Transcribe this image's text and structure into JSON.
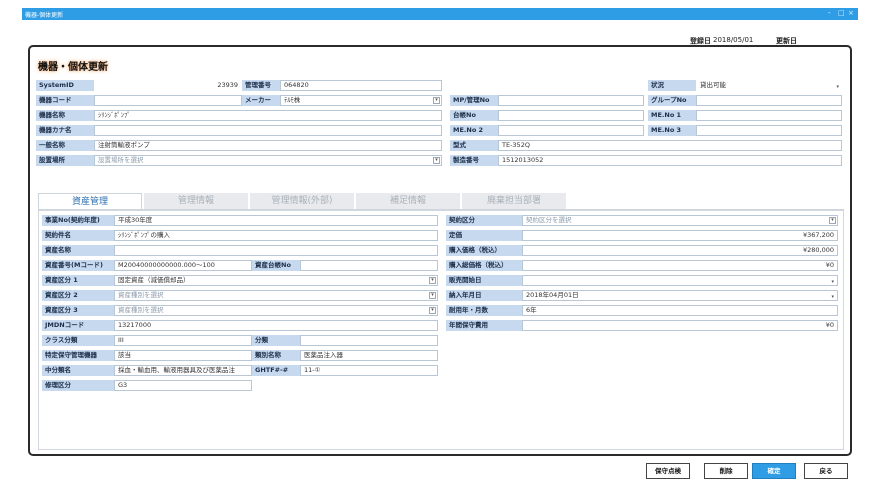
{
  "window": {
    "title": "機器-個体更新",
    "controls": [
      "-",
      "□",
      "×"
    ]
  },
  "header": {
    "registered_label": "登録日",
    "registered_date": "2018/05/01",
    "updated_label": "更新日"
  },
  "panel_title": "機器・個体更新",
  "top": {
    "system_id": {
      "label": "SystemID",
      "value": "23939"
    },
    "kanri_no": {
      "label": "管理番号",
      "value": "064820"
    },
    "status": {
      "label": "状況",
      "value": "貸出可能"
    },
    "kiki_code": {
      "label": "機器コード",
      "value": ""
    },
    "maker": {
      "label": "メーカー",
      "value": "ﾃﾙﾓ株"
    },
    "mp_no": {
      "label": "MP/管理No",
      "value": ""
    },
    "group_no": {
      "label": "グループNo",
      "value": ""
    },
    "kiki_name": {
      "label": "機器名称",
      "value": "ｼﾘﾝｼﾞﾎﾟﾝﾌﾟ"
    },
    "daicho_no": {
      "label": "台帳No",
      "value": ""
    },
    "me_no1": {
      "label": "ME.No 1",
      "value": ""
    },
    "kiki_kana": {
      "label": "機器カナ名",
      "value": ""
    },
    "me_no2": {
      "label": "ME.No 2",
      "value": ""
    },
    "me_no3": {
      "label": "ME.No 3",
      "value": ""
    },
    "ippan_name": {
      "label": "一般名称",
      "value": "注射筒輸液ポンプ"
    },
    "katashiki": {
      "label": "型式",
      "value": "TE-352Q"
    },
    "setchi": {
      "label": "設置場所",
      "placeholder": "設置場所を選択"
    },
    "seizo_no": {
      "label": "製造番号",
      "value": "1512013052"
    }
  },
  "tabs": [
    "資産管理",
    "管理情報",
    "管理情報(外部)",
    "補足情報",
    "廃棄担当部署"
  ],
  "asset": {
    "jigyo": {
      "label": "事業No(契約年度)",
      "value": "平成30年度"
    },
    "keiyaku_kubun": {
      "label": "契約区分",
      "placeholder": "契約区分を選択"
    },
    "keiyaku_name": {
      "label": "契約件名",
      "value": "ｼﾘﾝｼﾞﾎﾟﾝﾌﾟの購入"
    },
    "teika": {
      "label": "定価",
      "value": "¥367,200"
    },
    "shisan_name": {
      "label": "資産名称",
      "value": ""
    },
    "konyu_kakaku": {
      "label": "購入価格（税込）",
      "value": "¥280,000"
    },
    "shisan_no": {
      "label": "資産番号(Mコード)",
      "value": "M20040000000000.000～100"
    },
    "shisan_daicho": {
      "label": "資産台帳No",
      "value": ""
    },
    "konyu_sogaku": {
      "label": "購入総価格（税込）",
      "value": "¥0"
    },
    "kubun1": {
      "label": "資産区分 1",
      "value": "固定資産（減価償却品）"
    },
    "hanbai_start": {
      "label": "販売開始日",
      "value": ""
    },
    "kubun2": {
      "label": "資産区分 2",
      "placeholder": "資産種別を選択"
    },
    "nonyu_date": {
      "label": "納入年月日",
      "value": "2018年04月01日"
    },
    "kubun3": {
      "label": "資産区分 3",
      "placeholder": "資産種別を選択"
    },
    "taiyo": {
      "label": "耐用年・月数",
      "value": "6年"
    },
    "jmdn": {
      "label": "JMDNコード",
      "value": "13217000"
    },
    "hoshu_hiyo": {
      "label": "年間保守費用",
      "value": "¥0"
    },
    "class": {
      "label": "クラス分類",
      "value": "III"
    },
    "bunrui": {
      "label": "分類",
      "value": ""
    },
    "tokutei": {
      "label": "特定保守管理機器",
      "value": "該当"
    },
    "ruibetsu": {
      "label": "類別名称",
      "value": "医薬品注入器"
    },
    "chubunrui": {
      "label": "中分類名",
      "value": "採血・輸血用、輸液用器具及び医薬品注"
    },
    "ghtf": {
      "label": "GHTF#-#",
      "value": "11-①"
    },
    "shuri": {
      "label": "修理区分",
      "value": "G3"
    }
  },
  "buttons": {
    "hoshu": "保守点検",
    "delete": "削除",
    "confirm": "確定",
    "back": "戻る"
  }
}
